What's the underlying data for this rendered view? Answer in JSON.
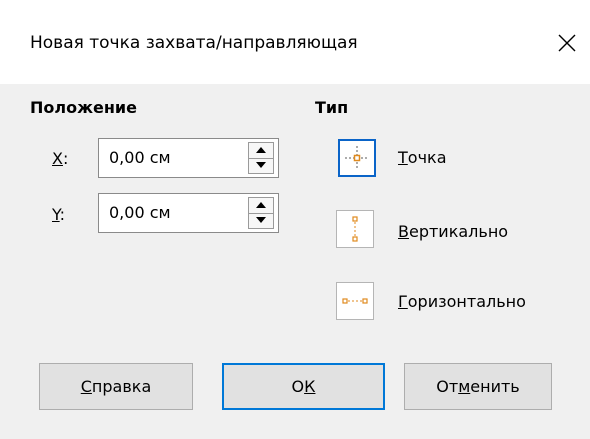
{
  "window": {
    "title": "Новая точка захвата/направляющая",
    "close_glyph": "close-icon"
  },
  "position": {
    "heading": "Положение",
    "x": {
      "label_u": "X",
      "label_rest": ":",
      "value": "0,00 см"
    },
    "y": {
      "label_u": "Y",
      "label_rest": ":",
      "value": "0,00 см"
    }
  },
  "type": {
    "heading": "Тип",
    "options": [
      {
        "u": "Т",
        "rest": "очка",
        "icon": "point-icon",
        "selected": true
      },
      {
        "u": "В",
        "rest": "ертикально",
        "icon": "vertical-icon",
        "selected": false
      },
      {
        "u": "Г",
        "rest": "оризонтально",
        "icon": "horizontal-icon",
        "selected": false
      }
    ]
  },
  "buttons": {
    "help": {
      "u": "С",
      "rest": "правка"
    },
    "ok": {
      "pre": "О",
      "u": "К"
    },
    "cancel": {
      "pre": "От",
      "u": "м",
      "rest": "енить"
    }
  },
  "colors": {
    "accent": "#0078d7",
    "handle": "#e08a1e"
  }
}
